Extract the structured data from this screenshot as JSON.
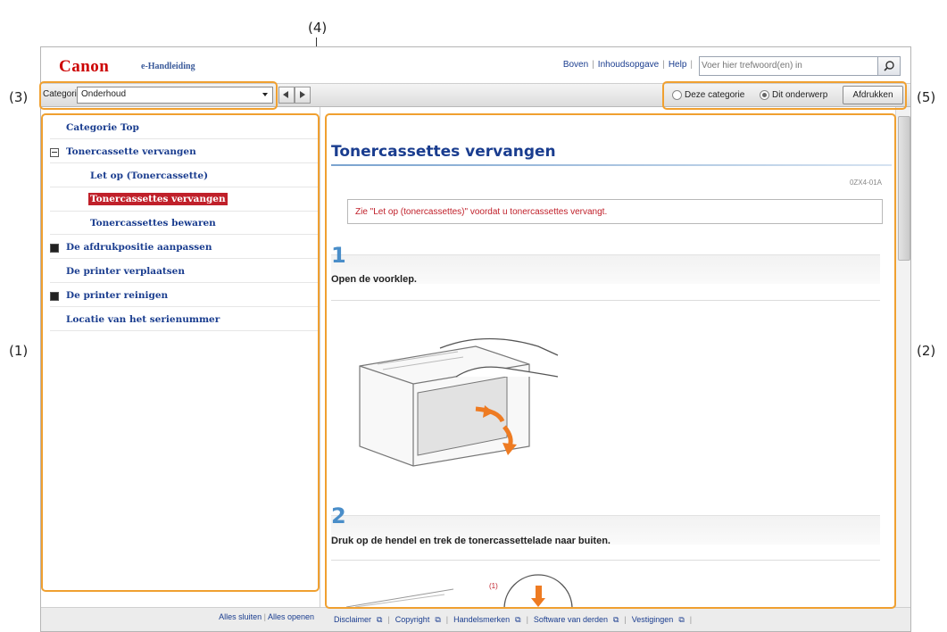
{
  "callouts": [
    "(1)",
    "(2)",
    "(3)",
    "(4)",
    "(5)"
  ],
  "header": {
    "logo": "Canon",
    "subtitle": "e-Handleiding",
    "links": [
      "Boven",
      "Inhoudsopgave",
      "Help"
    ],
    "search_placeholder": "Voer hier trefwoord(en) in"
  },
  "toolbar": {
    "category_label": "Categorie",
    "category_value": "Onderhoud",
    "radio_1": "Deze categorie",
    "radio_2": "Dit onderwerp",
    "print_button": "Afdrukken"
  },
  "sidebar": {
    "items": [
      "Categorie Top",
      "Tonercassette vervangen",
      "Let op (Tonercassette)",
      "Tonercassettes vervangen",
      "Tonercassettes bewaren",
      "De afdrukpositie aanpassen",
      "De printer verplaatsen",
      "De printer reinigen",
      "Locatie van het serienummer"
    ],
    "footer_links": [
      "Alles sluiten",
      "Alles openen"
    ]
  },
  "content": {
    "title": "Tonercassettes vervangen",
    "doc_id": "0ZX4-01A",
    "note": "Zie \"Let op (tonercassettes)\" voordat u tonercassettes vervangt.",
    "steps": [
      {
        "number": "1",
        "text": "Open de voorklep."
      },
      {
        "number": "2",
        "text": "Druk op de hendel en trek de tonercassettelade naar buiten."
      }
    ],
    "illustration_label": "(1)"
  },
  "footer": {
    "links": [
      "Disclaimer",
      "Copyright",
      "Handelsmerken",
      "Software van derden",
      "Vestigingen"
    ]
  },
  "colors": {
    "callout_border": "#f0a030",
    "link": "#1a3d8f",
    "brand_red": "#cc0000",
    "step_number": "#4a8ec9"
  }
}
